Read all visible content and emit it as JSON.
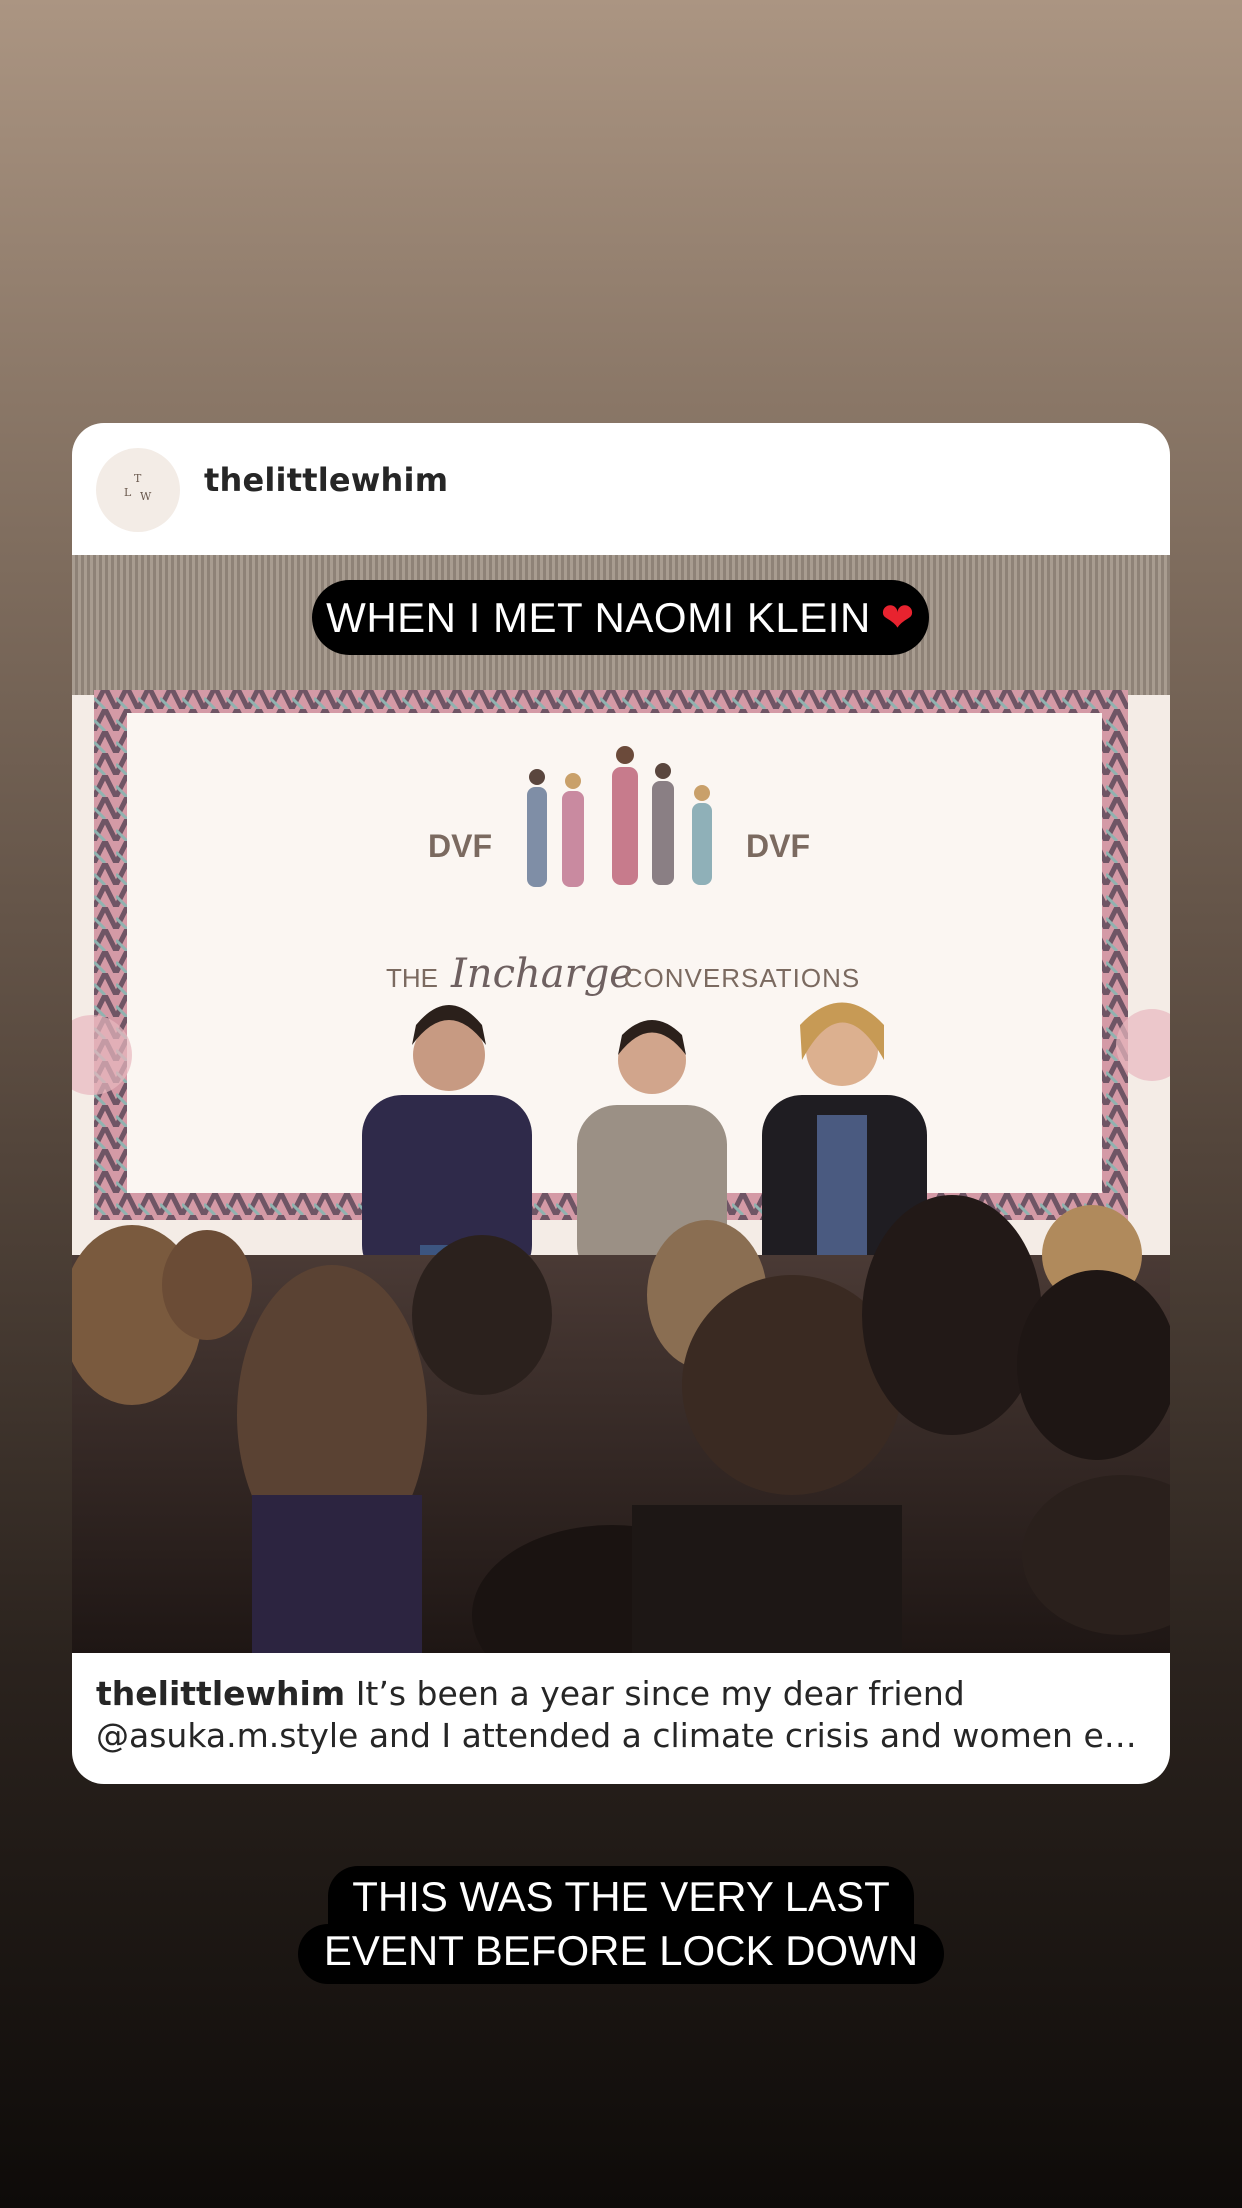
{
  "post": {
    "username": "thelittlewhim",
    "avatar_letters": [
      "T",
      "L",
      "W"
    ],
    "caption_username": "thelittlewhim",
    "caption_line1": "It’s been a year since my dear friend",
    "caption_line2": "@asuka.m.style and I attended a climate crisis and women e…"
  },
  "photo": {
    "brand_left": "DVF",
    "brand_right": "DVF",
    "banner_the": "THE",
    "banner_script": "Incharge",
    "banner_conversations": "CONVERSATIONS"
  },
  "stickers": {
    "top_text": "WHEN I MET NAOMI KLEIN",
    "top_emoji": "❤",
    "bottom_line1": "THIS WAS THE VERY LAST",
    "bottom_line2": "EVENT BEFORE LOCK DOWN"
  },
  "colors": {
    "sticker_bg": "#000000",
    "heart": "#e8232f",
    "card_bg": "#ffffff"
  }
}
